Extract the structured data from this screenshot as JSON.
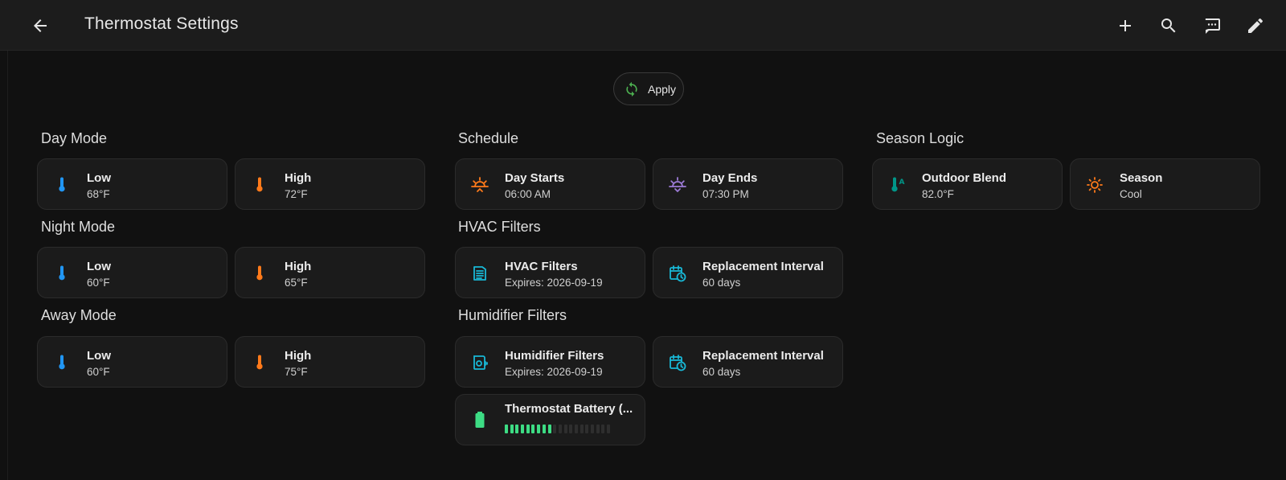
{
  "header": {
    "title": "Thermostat Settings",
    "back_icon": "arrow-left-icon",
    "actions": [
      {
        "name": "add",
        "icon": "plus-icon"
      },
      {
        "name": "search",
        "icon": "magnify-icon"
      },
      {
        "name": "assist",
        "icon": "comment-processing-icon"
      },
      {
        "name": "edit",
        "icon": "pencil-icon"
      }
    ]
  },
  "apply": {
    "label": "Apply",
    "icon": "sync-icon",
    "icon_color": "#4caf50"
  },
  "colors": {
    "cold": "#2196f3",
    "hot": "#ff7a1a",
    "sunrise": "#ff7a1a",
    "sunset": "#9c7bd6",
    "filter": "#18b8d6",
    "outdoor": "#009688",
    "battery": "#3ddc84"
  },
  "sections": {
    "day_mode": {
      "title": "Day Mode",
      "low": {
        "name": "Low",
        "state": "68°F",
        "icon": "thermometer-icon"
      },
      "high": {
        "name": "High",
        "state": "72°F",
        "icon": "thermometer-icon"
      }
    },
    "night_mode": {
      "title": "Night Mode",
      "low": {
        "name": "Low",
        "state": "60°F",
        "icon": "thermometer-icon"
      },
      "high": {
        "name": "High",
        "state": "65°F",
        "icon": "thermometer-icon"
      }
    },
    "away_mode": {
      "title": "Away Mode",
      "low": {
        "name": "Low",
        "state": "60°F",
        "icon": "thermometer-icon"
      },
      "high": {
        "name": "High",
        "state": "75°F",
        "icon": "thermometer-icon"
      }
    },
    "schedule": {
      "title": "Schedule",
      "day_starts": {
        "name": "Day Starts",
        "state": "06:00 AM",
        "icon": "sunrise-icon"
      },
      "day_ends": {
        "name": "Day Ends",
        "state": "07:30 PM",
        "icon": "sunset-icon"
      }
    },
    "hvac_filters": {
      "title": "HVAC Filters",
      "filters": {
        "name": "HVAC Filters",
        "state": "Expires: 2026-09-19",
        "icon": "air-filter-icon"
      },
      "interval": {
        "name": "Replacement Interval",
        "state": "60 days",
        "icon": "calendar-clock-icon"
      }
    },
    "humidifier_filters": {
      "title": "Humidifier Filters",
      "filters": {
        "name": "Humidifier Filters",
        "state": "Expires: 2026-09-19",
        "icon": "air-humidifier-icon"
      },
      "interval": {
        "name": "Replacement Interval",
        "state": "60 days",
        "icon": "calendar-clock-icon"
      },
      "battery": {
        "name": "Thermostat Battery (...",
        "icon": "battery-icon",
        "level_percent": 45,
        "segments_total": 20
      }
    },
    "season_logic": {
      "title": "Season Logic",
      "outdoor_blend": {
        "name": "Outdoor Blend",
        "state": "82.0°F",
        "icon": "thermometer-auto-icon"
      },
      "season": {
        "name": "Season",
        "state": "Cool",
        "icon": "sun-icon"
      }
    }
  }
}
